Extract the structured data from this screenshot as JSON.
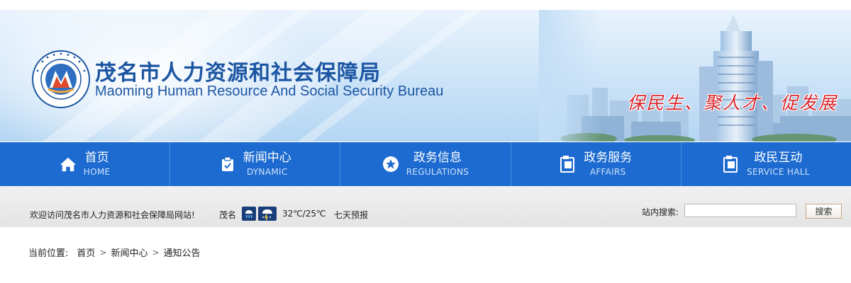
{
  "header": {
    "title_cn": "茂名市人力资源和社会保障局",
    "title_en": "Maoming Human Resource And Social Security Bureau",
    "logo_ring_text": "茂名市人力资源和社会保障局",
    "slogan": "保民生、聚人才、促发展"
  },
  "nav": {
    "items": [
      {
        "cn": "首页",
        "en": "HOME",
        "icon": "home-icon"
      },
      {
        "cn": "新闻中心",
        "en": "DYNAMIC",
        "icon": "clipboard-check-icon"
      },
      {
        "cn": "政务信息",
        "en": "REGULATIONS",
        "icon": "star-circle-icon"
      },
      {
        "cn": "政务服务",
        "en": "AFFAIRS",
        "icon": "document-icon"
      },
      {
        "cn": "政民互动",
        "en": "SERVICE HALL",
        "icon": "document-icon"
      }
    ]
  },
  "infobar": {
    "welcome": "欢迎访问茂名市人力资源和社会保障局网站!",
    "city": "茂名",
    "weather_icons": [
      "rain-icon",
      "thunderstorm-icon"
    ],
    "temperature": "32℃/25℃",
    "forecast_link": "七天预报",
    "search_label": "站内搜索:",
    "search_value": "",
    "search_button": "搜索"
  },
  "breadcrumb": {
    "label": "当前位置:",
    "items": [
      "首页",
      "新闻中心",
      "通知公告"
    ]
  },
  "colors": {
    "nav_bg": "#1d6bd0",
    "title": "#1c56a3",
    "slogan": "#d8262c"
  }
}
